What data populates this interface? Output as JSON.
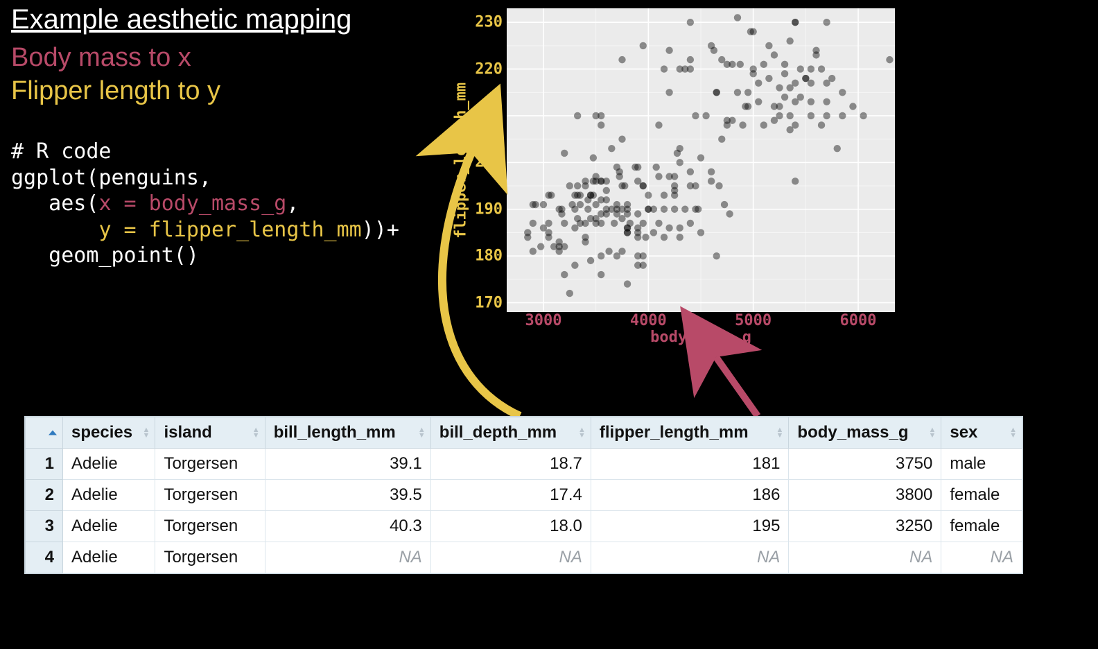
{
  "headings": {
    "title": "Example aesthetic mapping",
    "sub1": "Body mass to x",
    "sub2": "Flipper length to y"
  },
  "code": {
    "l1": "# R code",
    "l2": "ggplot(penguins,",
    "l3a": "   aes(",
    "l3b": "x = body_mass_g",
    "l3c": ",",
    "l4a": "       ",
    "l4b": "y = flipper_length_mm",
    "l4c": "))+",
    "l5": "   geom_point()"
  },
  "colors": {
    "pink": "#b84a68",
    "gold": "#e8c547"
  },
  "chart_data": {
    "type": "scatter",
    "title": "",
    "xlabel": "body_mass_g",
    "ylabel": "flipper_length_mm",
    "xlim": [
      2650,
      6350
    ],
    "ylim": [
      168,
      233
    ],
    "x_ticks": [
      3000,
      4000,
      5000,
      6000
    ],
    "y_ticks": [
      170,
      180,
      190,
      200,
      210,
      220,
      230
    ],
    "legend": null,
    "point_alpha": 0.42,
    "points": [
      [
        3750,
        181
      ],
      [
        3800,
        186
      ],
      [
        3250,
        195
      ],
      [
        3450,
        193
      ],
      [
        3650,
        190
      ],
      [
        3625,
        181
      ],
      [
        4675,
        195
      ],
      [
        3475,
        193
      ],
      [
        4250,
        190
      ],
      [
        3300,
        186
      ],
      [
        3700,
        180
      ],
      [
        3200,
        182
      ],
      [
        3800,
        191
      ],
      [
        4400,
        198
      ],
      [
        4500,
        185
      ],
      [
        3325,
        195
      ],
      [
        4200,
        197
      ],
      [
        3400,
        184
      ],
      [
        3600,
        194
      ],
      [
        3800,
        174
      ],
      [
        3950,
        180
      ],
      [
        3800,
        189
      ],
      [
        3800,
        185
      ],
      [
        3550,
        180
      ],
      [
        3200,
        187
      ],
      [
        3150,
        183
      ],
      [
        3950,
        187
      ],
      [
        3250,
        172
      ],
      [
        3900,
        180
      ],
      [
        3300,
        178
      ],
      [
        3900,
        178
      ],
      [
        3325,
        188
      ],
      [
        4150,
        184
      ],
      [
        3950,
        195
      ],
      [
        3550,
        196
      ],
      [
        3300,
        190
      ],
      [
        4650,
        180
      ],
      [
        3150,
        181
      ],
      [
        3900,
        184
      ],
      [
        3100,
        182
      ],
      [
        4400,
        195
      ],
      [
        3000,
        186
      ],
      [
        4600,
        196
      ],
      [
        3425,
        190
      ],
      [
        2975,
        182
      ],
      [
        3450,
        179
      ],
      [
        4150,
        190
      ],
      [
        3500,
        191
      ],
      [
        4300,
        186
      ],
      [
        3450,
        188
      ],
      [
        4050,
        190
      ],
      [
        2900,
        187
      ],
      [
        3700,
        189
      ],
      [
        3550,
        176
      ],
      [
        3800,
        186
      ],
      [
        2850,
        185
      ],
      [
        3750,
        190
      ],
      [
        3150,
        182
      ],
      [
        4400,
        187
      ],
      [
        3600,
        190
      ],
      [
        4050,
        185
      ],
      [
        2850,
        184
      ],
      [
        3950,
        195
      ],
      [
        3350,
        193
      ],
      [
        4100,
        187
      ],
      [
        3050,
        184
      ],
      [
        4450,
        195
      ],
      [
        3600,
        189
      ],
      [
        3900,
        196
      ],
      [
        3550,
        187
      ],
      [
        4150,
        193
      ],
      [
        3700,
        191
      ],
      [
        4250,
        194
      ],
      [
        3700,
        190
      ],
      [
        3900,
        189
      ],
      [
        3550,
        189
      ],
      [
        4000,
        190
      ],
      [
        3200,
        202
      ],
      [
        4700,
        205
      ],
      [
        3800,
        185
      ],
      [
        4200,
        186
      ],
      [
        3350,
        187
      ],
      [
        3550,
        208
      ],
      [
        3800,
        190
      ],
      [
        3500,
        196
      ],
      [
        3950,
        178
      ],
      [
        3600,
        192
      ],
      [
        3550,
        192
      ],
      [
        4300,
        203
      ],
      [
        3400,
        183
      ],
      [
        4450,
        190
      ],
      [
        3300,
        193
      ],
      [
        4300,
        184
      ],
      [
        3700,
        199
      ],
      [
        4350,
        190
      ],
      [
        2900,
        181
      ],
      [
        4100,
        197
      ],
      [
        3725,
        198
      ],
      [
        4725,
        191
      ],
      [
        3075,
        193
      ],
      [
        4250,
        197
      ],
      [
        2925,
        191
      ],
      [
        3550,
        196
      ],
      [
        3750,
        188
      ],
      [
        3900,
        199
      ],
      [
        3175,
        189
      ],
      [
        4775,
        189
      ],
      [
        3825,
        187
      ],
      [
        4600,
        198
      ],
      [
        3200,
        176
      ],
      [
        4275,
        202
      ],
      [
        3900,
        186
      ],
      [
        4075,
        199
      ],
      [
        2900,
        191
      ],
      [
        3775,
        195
      ],
      [
        3350,
        191
      ],
      [
        3325,
        210
      ],
      [
        3150,
        190
      ],
      [
        3500,
        197
      ],
      [
        3450,
        193
      ],
      [
        3875,
        199
      ],
      [
        3050,
        187
      ],
      [
        4000,
        190
      ],
      [
        3275,
        191
      ],
      [
        4300,
        200
      ],
      [
        3050,
        185
      ],
      [
        4000,
        193
      ],
      [
        3325,
        193
      ],
      [
        3500,
        187
      ],
      [
        3500,
        188
      ],
      [
        4475,
        190
      ],
      [
        3425,
        192
      ],
      [
        3900,
        185
      ],
      [
        3175,
        190
      ],
      [
        3975,
        184
      ],
      [
        3400,
        195
      ],
      [
        4250,
        193
      ],
      [
        3400,
        187
      ],
      [
        3475,
        201
      ],
      [
        3050,
        193
      ],
      [
        3725,
        197
      ],
      [
        3000,
        191
      ],
      [
        3650,
        203
      ],
      [
        4250,
        195
      ],
      [
        3750,
        195
      ],
      [
        3550,
        210
      ],
      [
        3750,
        205
      ],
      [
        3500,
        210
      ],
      [
        3675,
        187
      ],
      [
        3400,
        196
      ],
      [
        3475,
        196
      ],
      [
        3600,
        196
      ],
      [
        4500,
        201
      ],
      [
        5700,
        210
      ],
      [
        4450,
        210
      ],
      [
        5700,
        213
      ],
      [
        5400,
        217
      ],
      [
        4550,
        210
      ],
      [
        4800,
        221
      ],
      [
        5200,
        209
      ],
      [
        4400,
        222
      ],
      [
        5150,
        218
      ],
      [
        4650,
        215
      ],
      [
        5550,
        213
      ],
      [
        4650,
        215
      ],
      [
        5850,
        215
      ],
      [
        4200,
        215
      ],
      [
        5850,
        210
      ],
      [
        4150,
        220
      ],
      [
        6300,
        222
      ],
      [
        4800,
        209
      ],
      [
        5350,
        207
      ],
      [
        5700,
        230
      ],
      [
        5000,
        220
      ],
      [
        4400,
        220
      ],
      [
        5050,
        213
      ],
      [
        5000,
        219
      ],
      [
        5100,
        208
      ],
      [
        4100,
        208
      ],
      [
        5650,
        208
      ],
      [
        4600,
        225
      ],
      [
        5550,
        210
      ],
      [
        5250,
        216
      ],
      [
        4700,
        222
      ],
      [
        5050,
        217
      ],
      [
        6050,
        210
      ],
      [
        5150,
        225
      ],
      [
        5400,
        213
      ],
      [
        4950,
        215
      ],
      [
        5250,
        210
      ],
      [
        4350,
        220
      ],
      [
        5350,
        210
      ],
      [
        3950,
        225
      ],
      [
        5700,
        217
      ],
      [
        4300,
        220
      ],
      [
        4750,
        208
      ],
      [
        5550,
        220
      ],
      [
        4900,
        208
      ],
      [
        4200,
        224
      ],
      [
        5400,
        208
      ],
      [
        5100,
        221
      ],
      [
        5300,
        214
      ],
      [
        4850,
        231
      ],
      [
        5300,
        219
      ],
      [
        4400,
        230
      ],
      [
        5450,
        220
      ],
      [
        5600,
        223
      ],
      [
        5300,
        221
      ],
      [
        4875,
        221
      ],
      [
        5550,
        217
      ],
      [
        5400,
        230
      ],
      [
        4750,
        209
      ],
      [
        5650,
        220
      ],
      [
        4850,
        215
      ],
      [
        5200,
        223
      ],
      [
        4925,
        212
      ],
      [
        4750,
        221
      ],
      [
        5250,
        212
      ],
      [
        5600,
        224
      ],
      [
        5200,
        212
      ],
      [
        4975,
        228
      ],
      [
        5500,
        218
      ],
      [
        5500,
        218
      ],
      [
        4950,
        212
      ],
      [
        5400,
        230
      ],
      [
        5750,
        218
      ],
      [
        5000,
        228
      ],
      [
        5950,
        212
      ],
      [
        4625,
        224
      ],
      [
        5450,
        214
      ],
      [
        5350,
        226
      ],
      [
        5350,
        216
      ],
      [
        3750,
        222
      ],
      [
        5800,
        203
      ],
      [
        5400,
        196
      ]
    ]
  },
  "table": {
    "headers": [
      "species",
      "island",
      "bill_length_mm",
      "bill_depth_mm",
      "flipper_length_mm",
      "body_mass_g",
      "sex"
    ],
    "numeric_cols": [
      false,
      false,
      true,
      true,
      true,
      true,
      false
    ],
    "rows": [
      [
        "Adelie",
        "Torgersen",
        "39.1",
        "18.7",
        "181",
        "3750",
        "male"
      ],
      [
        "Adelie",
        "Torgersen",
        "39.5",
        "17.4",
        "186",
        "3800",
        "female"
      ],
      [
        "Adelie",
        "Torgersen",
        "40.3",
        "18.0",
        "195",
        "3250",
        "female"
      ],
      [
        "Adelie",
        "Torgersen",
        "NA",
        "NA",
        "NA",
        "NA",
        "NA"
      ]
    ]
  }
}
